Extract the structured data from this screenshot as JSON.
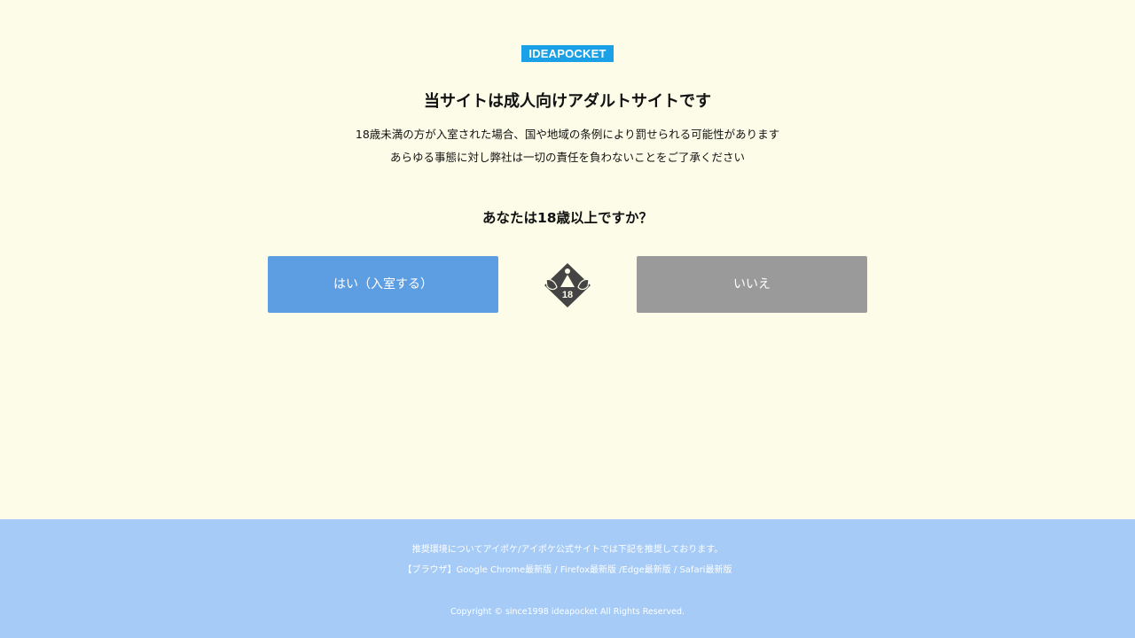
{
  "logo": {
    "text": "IDEAPOCKET"
  },
  "warning": {
    "title": "当サイトは成人向けアダルトサイトです",
    "line1": "18歳未満の方が入室された場合、国や地域の条例により罰せられる可能性があります",
    "line2": "あらゆる事態に対し弊社は一切の責任を負わないことをご了承ください"
  },
  "age_check": {
    "question": "あなたは18歳以上ですか？",
    "yes_label": "はい（入室する）",
    "no_label": "いいえ",
    "badge_text": "18",
    "badge_icon": "adults-only-18-icon"
  },
  "footer": {
    "line1": "推奨環境についてアイポケ/アイポケ公式サイトでは下記を推奨しております。",
    "line2": "【ブラウザ】Google Chrome最新版 / Firefox最新版 /Edge最新版 / Safari最新版",
    "copyright": "Copyright © since1998 ideapocket All Rights Reserved."
  },
  "colors": {
    "background": "#fdfce8",
    "logo_bg": "#1aa0e6",
    "yes_button": "#5d9ee2",
    "no_button": "#9a9a9a",
    "footer_bg": "#a6cbf6"
  }
}
